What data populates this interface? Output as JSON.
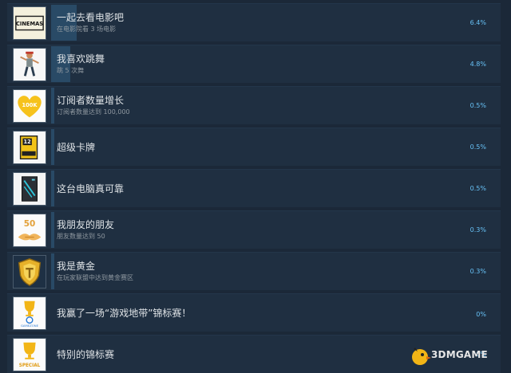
{
  "achievements": [
    {
      "title": "一起去看电影吧",
      "description": "在电影院看 3 场电影",
      "percent": "6.4%",
      "progress": 6.4,
      "icon": "cinemas-icon",
      "icon_text": "CINEMAS"
    },
    {
      "title": "我喜欢跳舞",
      "description": "跳 5 次舞",
      "percent": "4.8%",
      "progress": 4.8,
      "icon": "dancer-icon"
    },
    {
      "title": "订阅者数量增长",
      "description": "订阅者数量达到 100,000",
      "percent": "0.5%",
      "progress": 0.5,
      "icon": "heart-100k-icon",
      "icon_text": "100K"
    },
    {
      "title": "超级卡牌",
      "description": "",
      "percent": "0.5%",
      "progress": 0.5,
      "icon": "card-pack-icon",
      "icon_text": "12"
    },
    {
      "title": "这台电脑真可靠",
      "description": "",
      "percent": "0.5%",
      "progress": 0.5,
      "icon": "pc-case-icon"
    },
    {
      "title": "我朋友的朋友",
      "description": "朋友数量达到 50",
      "percent": "0.3%",
      "progress": 0.3,
      "icon": "handshake-50-icon",
      "icon_text": "50"
    },
    {
      "title": "我是黄金",
      "description": "在玩家联盟中达到黄金赛区",
      "percent": "0.3%",
      "progress": 0.3,
      "icon": "gold-shield-icon"
    },
    {
      "title": "我赢了一场“游戏地带”锦标赛！",
      "description": "",
      "percent": "0%",
      "progress": 0,
      "icon": "trophy-gamezone-icon",
      "icon_text": "GAMEZONE"
    },
    {
      "title": "特别的锦标赛",
      "description": "",
      "percent": "0%",
      "progress": 0,
      "icon": "trophy-special-icon",
      "icon_text": "SPECIAL"
    }
  ],
  "watermark": {
    "text": "3DMGAME"
  },
  "colors": {
    "background": "#1b2838",
    "row": "#1f2f41",
    "bar": "#294a66",
    "percent": "#67c1f5"
  }
}
